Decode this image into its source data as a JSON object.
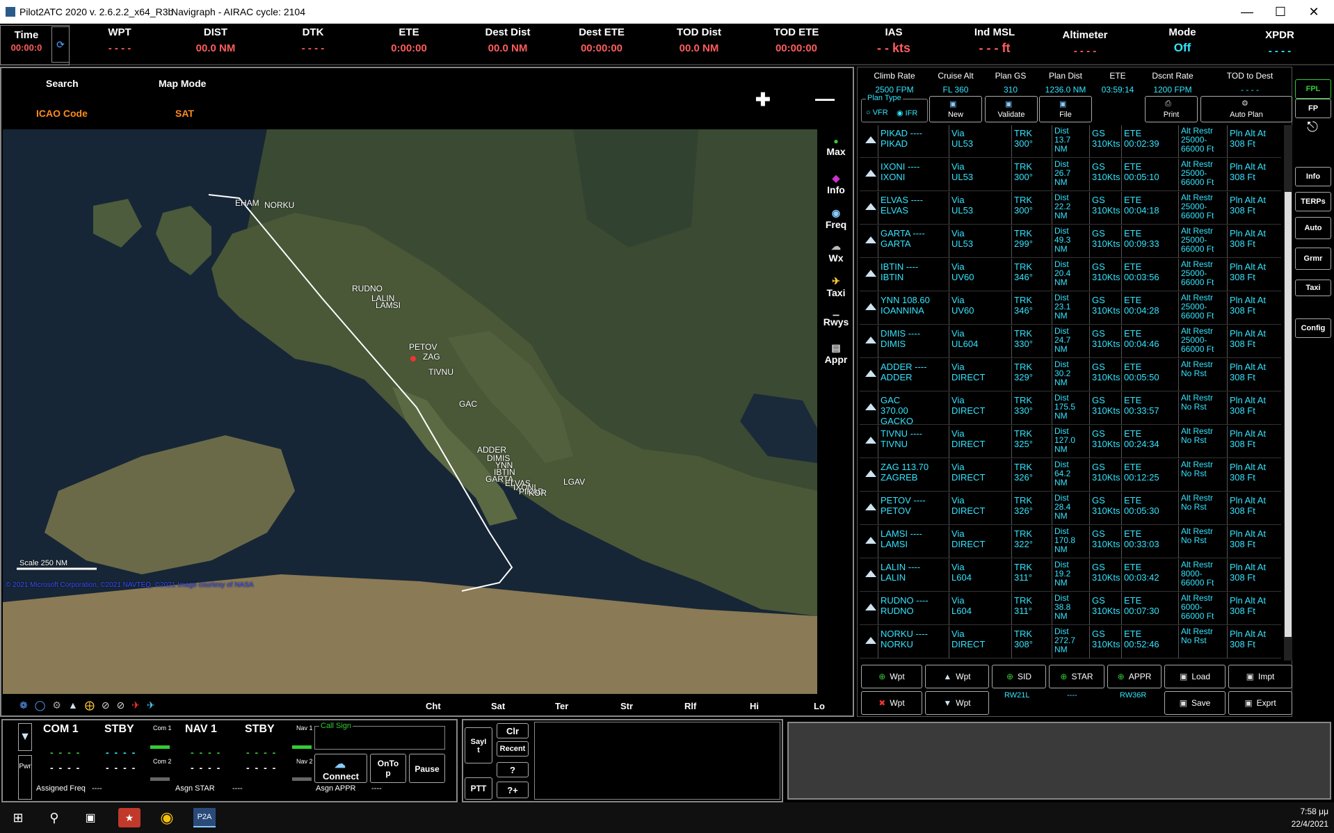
{
  "titlebar": {
    "app": "Pilot2ATC 2020 v. 2.6.2.2_x64_R3b",
    "db": "Navigraph - AIRAC cycle: 2104"
  },
  "top": {
    "time_label": "Time",
    "time_value": "00:00:0",
    "cols": [
      {
        "label": "WPT",
        "value": "- - - -"
      },
      {
        "label": "DIST",
        "value": "00.0 NM"
      },
      {
        "label": "DTK",
        "value": "- - - -"
      },
      {
        "label": "ETE",
        "value": "0:00:00"
      },
      {
        "label": "Dest Dist",
        "value": "00.0 NM"
      },
      {
        "label": "Dest ETE",
        "value": "00:00:00"
      },
      {
        "label": "TOD Dist",
        "value": "00.0 NM"
      },
      {
        "label": "TOD ETE",
        "value": "00:00:00"
      },
      {
        "label": "IAS",
        "value": "- - kts"
      },
      {
        "label": "Ind MSL",
        "value": "- - - ft"
      },
      {
        "label": "Altimeter",
        "value": "- - - -"
      },
      {
        "label": "Mode",
        "value": "Off"
      },
      {
        "label": "XPDR",
        "value": "- - - -"
      }
    ]
  },
  "map": {
    "search_label": "Search",
    "mapmode_label": "Map Mode",
    "icao_label": "ICAO Code",
    "sat_label": "SAT",
    "side": [
      "Max",
      "Info",
      "Freq",
      "Wx",
      "Taxi",
      "Rwys",
      "Appr"
    ],
    "scale": "Scale 250 NM",
    "copyright": "© 2021 Microsoft Corporation, ©2021 NAVTEQ, ©2021 Image courtesy of NASA",
    "modes": [
      "Cht",
      "Sat",
      "Ter",
      "Str",
      "Rlf",
      "Hi",
      "Lo"
    ],
    "waypoints": [
      "EHAM",
      "NORKU",
      "RUDNO",
      "LALIN",
      "LAMSI",
      "PETOV",
      "ZAG",
      "TIVNU",
      "GAC",
      "ADDER",
      "DIMIS",
      "YNN",
      "IBTIN",
      "GARTA",
      "ELVAS",
      "IXONI",
      "PIKAD",
      "KOR",
      "LGAV"
    ]
  },
  "fpl": {
    "headers": [
      {
        "label": "Climb Rate",
        "value": "2500 FPM"
      },
      {
        "label": "Cruise Alt",
        "value": "FL 360"
      },
      {
        "label": "Plan GS",
        "value": "310"
      },
      {
        "label": "Plan Dist",
        "value": "1236.0 NM"
      },
      {
        "label": "ETE",
        "value": "03:59:14"
      },
      {
        "label": "Dscnt Rate",
        "value": "1200 FPM"
      },
      {
        "label": "TOD to Dest",
        "value": "- - - -"
      }
    ],
    "plan_type": "Plan Type",
    "vfr": "VFR",
    "ifr": "IFR",
    "buttons": [
      "New",
      "Validate",
      "File",
      "Print",
      "Auto Plan"
    ],
    "rows": [
      {
        "id": "PIKAD ----",
        "name": "PIKAD",
        "via": "UL53",
        "trk": "300°",
        "dist": "13.7 NM",
        "ete": "00:02:39",
        "alt": "Alt Restr 25000-66000 Ft"
      },
      {
        "id": "IXONI ----",
        "name": "IXONI",
        "via": "UL53",
        "trk": "300°",
        "dist": "26.7 NM",
        "ete": "00:05:10",
        "alt": "Alt Restr 25000-66000 Ft"
      },
      {
        "id": "ELVAS ----",
        "name": "ELVAS",
        "via": "UL53",
        "trk": "300°",
        "dist": "22.2 NM",
        "ete": "00:04:18",
        "alt": "Alt Restr 25000-66000 Ft"
      },
      {
        "id": "GARTA ----",
        "name": "GARTA",
        "via": "UL53",
        "trk": "299°",
        "dist": "49.3 NM",
        "ete": "00:09:33",
        "alt": "Alt Restr 25000-66000 Ft"
      },
      {
        "id": "IBTIN ----",
        "name": "IBTIN",
        "via": "UV60",
        "trk": "346°",
        "dist": "20.4 NM",
        "ete": "00:03:56",
        "alt": "Alt Restr 25000-66000 Ft"
      },
      {
        "id": "YNN 108.60",
        "name": "IOANNINA",
        "via": "UV60",
        "trk": "346°",
        "dist": "23.1 NM",
        "ete": "00:04:28",
        "alt": "Alt Restr 25000-66000 Ft"
      },
      {
        "id": "DIMIS ----",
        "name": "DIMIS",
        "via": "UL604",
        "trk": "330°",
        "dist": "24.7 NM",
        "ete": "00:04:46",
        "alt": "Alt Restr 25000-66000 Ft"
      },
      {
        "id": "ADDER ----",
        "name": "ADDER",
        "via": "DIRECT",
        "trk": "329°",
        "dist": "30.2 NM",
        "ete": "00:05:50",
        "alt": "Alt Restr No Rst"
      },
      {
        "id": "GAC 370.00",
        "name": "GACKO",
        "via": "DIRECT",
        "trk": "330°",
        "dist": "175.5 NM",
        "ete": "00:33:57",
        "alt": "Alt Restr No Rst"
      },
      {
        "id": "TIVNU ----",
        "name": "TIVNU",
        "via": "DIRECT",
        "trk": "325°",
        "dist": "127.0 NM",
        "ete": "00:24:34",
        "alt": "Alt Restr No Rst"
      },
      {
        "id": "ZAG 113.70",
        "name": "ZAGREB",
        "via": "DIRECT",
        "trk": "326°",
        "dist": "64.2 NM",
        "ete": "00:12:25",
        "alt": "Alt Restr No Rst"
      },
      {
        "id": "PETOV ----",
        "name": "PETOV",
        "via": "DIRECT",
        "trk": "326°",
        "dist": "28.4 NM",
        "ete": "00:05:30",
        "alt": "Alt Restr No Rst"
      },
      {
        "id": "LAMSI ----",
        "name": "LAMSI",
        "via": "DIRECT",
        "trk": "322°",
        "dist": "170.8 NM",
        "ete": "00:33:03",
        "alt": "Alt Restr No Rst"
      },
      {
        "id": "LALIN ----",
        "name": "LALIN",
        "via": "L604",
        "trk": "311°",
        "dist": "19.2 NM",
        "ete": "00:03:42",
        "alt": "Alt Restr 8000-66000 Ft"
      },
      {
        "id": "RUDNO ----",
        "name": "RUDNO",
        "via": "L604",
        "trk": "311°",
        "dist": "38.8 NM",
        "ete": "00:07:30",
        "alt": "Alt Restr 6000-66000 Ft"
      },
      {
        "id": "NORKU ----",
        "name": "NORKU",
        "via": "DIRECT",
        "trk": "308°",
        "dist": "272.7 NM",
        "ete": "00:52:46",
        "alt": "Alt Restr No Rst"
      }
    ],
    "gs": "GS 310Kts",
    "plnalt": "Pln Alt At 308 Ft",
    "bottom": [
      "Wpt",
      "Wpt",
      "SID",
      "STAR",
      "APPR",
      "Load",
      "Impt",
      "Wpt",
      "Wpt",
      "Save",
      "Exprt"
    ],
    "sid_val": "RW21L",
    "star_val": "----",
    "appr_val": "RW36R"
  },
  "right_tabs": [
    "FPL",
    "FP",
    "Info",
    "TERPs",
    "Auto",
    "Grmr",
    "Taxi",
    "Config"
  ],
  "radio": {
    "com1": "COM 1",
    "stby": "STBY",
    "nav1": "NAV 1",
    "stby2": "STBY",
    "com1_small": "Com 1",
    "com2_small": "Com 2",
    "nav1_small": "Nav 1",
    "nav2_small": "Nav 2",
    "assigned_freq": "Assigned Freq",
    "assigned_freq_val": "----",
    "asgn_star": "Asgn STAR",
    "asgn_star_val": "----",
    "asgn_appr": "Asgn APPR",
    "asgn_appr_val": "----",
    "call_sign": "Call Sign",
    "connect": "Connect",
    "ontop": "OnTop",
    "pause": "Pause",
    "pwr": "Pwr",
    "sayit": "SayIt",
    "clr": "Clr",
    "recent": "Recent",
    "q": "?",
    "qplus": "?+",
    "ptt": "PTT"
  },
  "clock": {
    "time": "7:58 μμ",
    "date": "22/4/2021"
  }
}
